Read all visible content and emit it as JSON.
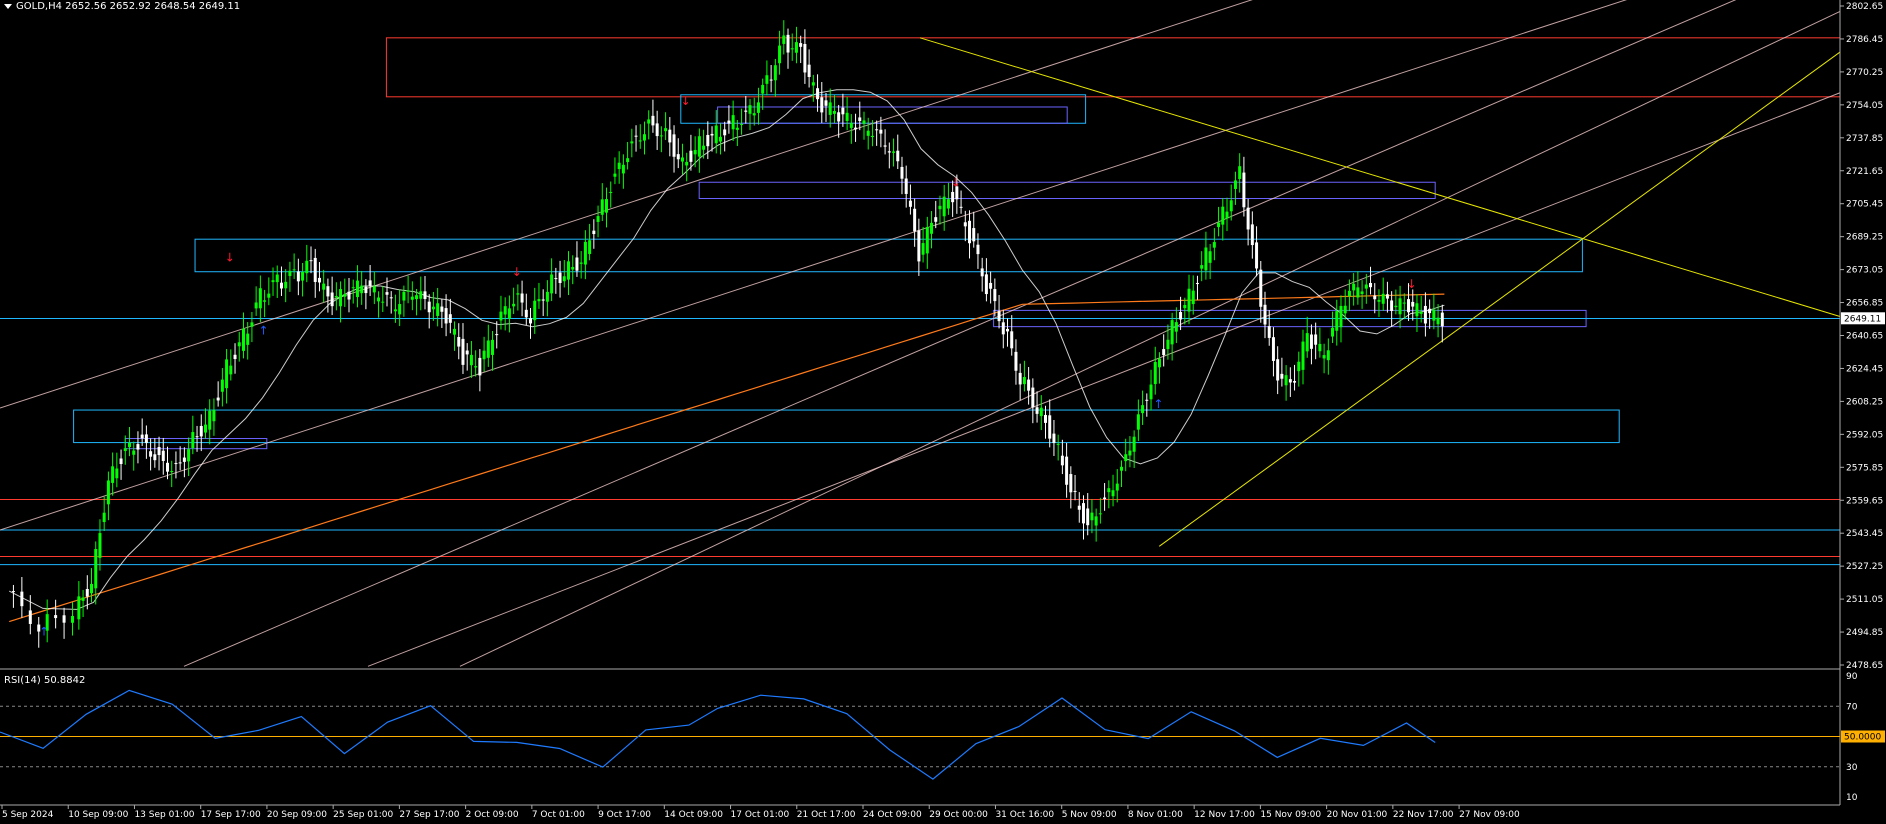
{
  "header": {
    "symbol": "GOLD,H4",
    "ohlc": "2652.56 2652.92 2648.54 2649.11"
  },
  "rsi": {
    "label": "RSI(14) 50.8842",
    "current_tag": "50.0000",
    "levels": [
      10,
      30,
      50,
      70,
      90
    ]
  },
  "price_tag": "2649.11",
  "colors": {
    "background": "#000000",
    "bull": "#00ff00",
    "bear": "#ffffff",
    "zone_red": "#ff3b30",
    "zone_blue": "#1fb8ff",
    "zone_purple": "#6b63ff",
    "trend_yellow": "#e6e600",
    "channel_pink": "#f3c9c9",
    "ma_orange": "#ff7a1a",
    "ma_white": "#ffffff",
    "rsi_line": "#1e7bff",
    "rsi_50": "#ffb000",
    "arrow_up": "#1e5bff",
    "arrow_down": "#ff1a2e"
  },
  "chart_data": {
    "type": "candlestick",
    "title": "GOLD,H4",
    "y_ticks": [
      "2802.65",
      "2786.45",
      "2770.25",
      "2754.05",
      "2737.85",
      "2721.65",
      "2705.45",
      "2689.25",
      "2673.05",
      "2656.85",
      "2640.65",
      "2624.45",
      "2608.25",
      "2592.05",
      "2575.85",
      "2559.65",
      "2543.45",
      "2527.25",
      "2511.05",
      "2494.85",
      "2478.65"
    ],
    "ylim": [
      2478.65,
      2802.65
    ],
    "x_ticks": [
      "5 Sep 2024",
      "10 Sep 09:00",
      "13 Sep 01:00",
      "17 Sep 17:00",
      "20 Sep 09:00",
      "25 Sep 01:00",
      "27 Sep 17:00",
      "2 Oct 09:00",
      "7 Oct 01:00",
      "9 Oct 17:00",
      "14 Oct 09:00",
      "17 Oct 01:00",
      "21 Oct 17:00",
      "24 Oct 09:00",
      "29 Oct 00:00",
      "31 Oct 16:00",
      "5 Nov 09:00",
      "8 Nov 01:00",
      "12 Nov 17:00",
      "15 Nov 09:00",
      "20 Nov 01:00",
      "22 Nov 17:00",
      "27 Nov 09:00"
    ],
    "price_path": [
      [
        0,
        2515
      ],
      [
        4,
        2498
      ],
      [
        8,
        2505
      ],
      [
        10,
        2520
      ],
      [
        12,
        2570
      ],
      [
        14,
        2585
      ],
      [
        16,
        2589
      ],
      [
        18,
        2580
      ],
      [
        20,
        2575
      ],
      [
        22,
        2590
      ],
      [
        24,
        2600
      ],
      [
        26,
        2625
      ],
      [
        28,
        2640
      ],
      [
        30,
        2660
      ],
      [
        32,
        2667
      ],
      [
        34,
        2670
      ],
      [
        36,
        2675
      ],
      [
        38,
        2658
      ],
      [
        40,
        2660
      ],
      [
        42,
        2665
      ],
      [
        44,
        2660
      ],
      [
        46,
        2655
      ],
      [
        48,
        2662
      ],
      [
        50,
        2655
      ],
      [
        52,
        2650
      ],
      [
        54,
        2630
      ],
      [
        56,
        2625
      ],
      [
        58,
        2645
      ],
      [
        60,
        2660
      ],
      [
        62,
        2650
      ],
      [
        64,
        2665
      ],
      [
        66,
        2672
      ],
      [
        68,
        2678
      ],
      [
        70,
        2700
      ],
      [
        72,
        2720
      ],
      [
        74,
        2735
      ],
      [
        76,
        2745
      ],
      [
        78,
        2740
      ],
      [
        80,
        2725
      ],
      [
        82,
        2735
      ],
      [
        84,
        2740
      ],
      [
        86,
        2745
      ],
      [
        88,
        2750
      ],
      [
        90,
        2765
      ],
      [
        92,
        2785
      ],
      [
        94,
        2780
      ],
      [
        96,
        2755
      ],
      [
        98,
        2750
      ],
      [
        100,
        2745
      ],
      [
        102,
        2742
      ],
      [
        104,
        2735
      ],
      [
        106,
        2720
      ],
      [
        108,
        2680
      ],
      [
        110,
        2700
      ],
      [
        112,
        2710
      ],
      [
        114,
        2690
      ],
      [
        116,
        2665
      ],
      [
        118,
        2645
      ],
      [
        120,
        2620
      ],
      [
        122,
        2605
      ],
      [
        124,
        2590
      ],
      [
        126,
        2565
      ],
      [
        128,
        2548
      ],
      [
        130,
        2560
      ],
      [
        132,
        2575
      ],
      [
        134,
        2600
      ],
      [
        136,
        2625
      ],
      [
        138,
        2645
      ],
      [
        140,
        2660
      ],
      [
        142,
        2680
      ],
      [
        144,
        2700
      ],
      [
        146,
        2720
      ],
      [
        148,
        2670
      ],
      [
        150,
        2625
      ],
      [
        152,
        2615
      ],
      [
        154,
        2640
      ],
      [
        156,
        2630
      ],
      [
        158,
        2655
      ],
      [
        160,
        2665
      ],
      [
        162,
        2660
      ],
      [
        164,
        2655
      ],
      [
        166,
        2655
      ],
      [
        168,
        2650
      ],
      [
        170,
        2649
      ]
    ],
    "zones": [
      {
        "kind": "red",
        "top": 2787,
        "bottom": 2758,
        "from": 0.21,
        "to": 1.0
      },
      {
        "kind": "blue",
        "top": 2759,
        "bottom": 2745,
        "from": 0.37,
        "to": 0.59
      },
      {
        "kind": "purple",
        "top": 2753,
        "bottom": 2745,
        "from": 0.39,
        "to": 0.58
      },
      {
        "kind": "purple",
        "top": 2716,
        "bottom": 2708,
        "from": 0.38,
        "to": 0.78
      },
      {
        "kind": "blue",
        "top": 2688,
        "bottom": 2672,
        "from": 0.106,
        "to": 0.86
      },
      {
        "kind": "purple",
        "top": 2653,
        "bottom": 2645,
        "from": 0.54,
        "to": 0.862
      },
      {
        "kind": "blue",
        "top": 2604,
        "bottom": 2588,
        "from": 0.04,
        "to": 0.88
      },
      {
        "kind": "purple",
        "top": 2590,
        "bottom": 2585,
        "from": 0.068,
        "to": 0.145
      }
    ],
    "hlines": [
      {
        "kind": "red",
        "y": 2560
      },
      {
        "kind": "blue",
        "y": 2545
      },
      {
        "kind": "red",
        "y": 2532
      },
      {
        "kind": "blue",
        "y": 2528
      },
      {
        "kind": "blue",
        "y": 2649
      }
    ],
    "rsi_path": [
      [
        0,
        53
      ],
      [
        6,
        42
      ],
      [
        12,
        65
      ],
      [
        18,
        80
      ],
      [
        24,
        72
      ],
      [
        30,
        48
      ],
      [
        36,
        55
      ],
      [
        42,
        62
      ],
      [
        48,
        40
      ],
      [
        54,
        58
      ],
      [
        60,
        72
      ],
      [
        66,
        45
      ],
      [
        72,
        48
      ],
      [
        78,
        40
      ],
      [
        84,
        32
      ],
      [
        90,
        52
      ],
      [
        96,
        60
      ],
      [
        100,
        66
      ],
      [
        106,
        80
      ],
      [
        112,
        72
      ],
      [
        118,
        68
      ],
      [
        124,
        38
      ],
      [
        130,
        25
      ],
      [
        136,
        42
      ],
      [
        142,
        60
      ],
      [
        148,
        72
      ],
      [
        154,
        58
      ],
      [
        160,
        45
      ],
      [
        166,
        70
      ],
      [
        172,
        50
      ],
      [
        178,
        40
      ],
      [
        184,
        45
      ],
      [
        190,
        48
      ],
      [
        196,
        55
      ],
      [
        200,
        50
      ]
    ],
    "rsi_ylim": [
      10,
      90
    ]
  }
}
